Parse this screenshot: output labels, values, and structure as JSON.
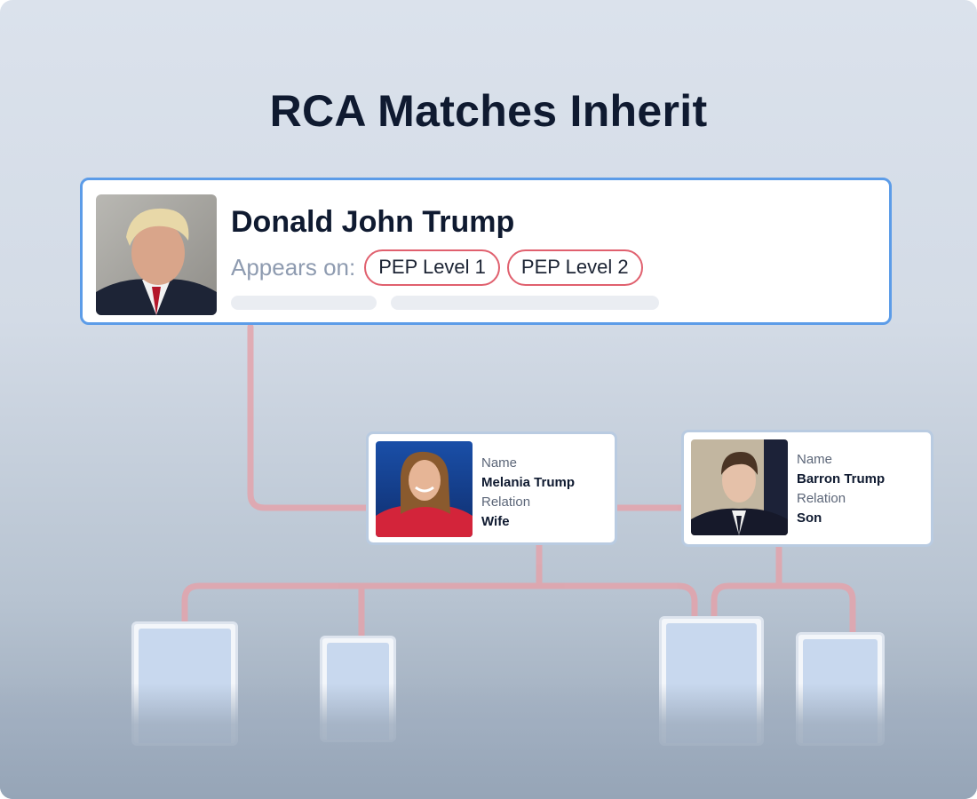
{
  "title": "RCA Matches Inherit",
  "colors": {
    "accent_border": "#5c9ce8",
    "tag_border": "#e0606e",
    "connector": "#e3a3ab",
    "text_dark": "#0f1a30",
    "text_muted": "#8e9bb0"
  },
  "main_subject": {
    "name": "Donald John Trump",
    "appears_label": "Appears on:",
    "tags": [
      "PEP Level 1",
      "PEP Level 2"
    ],
    "photo_icon": "person-photo"
  },
  "relatives": [
    {
      "name_label": "Name",
      "name": "Melania Trump",
      "relation_label": "Relation",
      "relation": "Wife",
      "photo_icon": "person-photo"
    },
    {
      "name_label": "Name",
      "name": "Barron Trump",
      "relation_label": "Relation",
      "relation": "Son",
      "photo_icon": "person-photo"
    }
  ]
}
